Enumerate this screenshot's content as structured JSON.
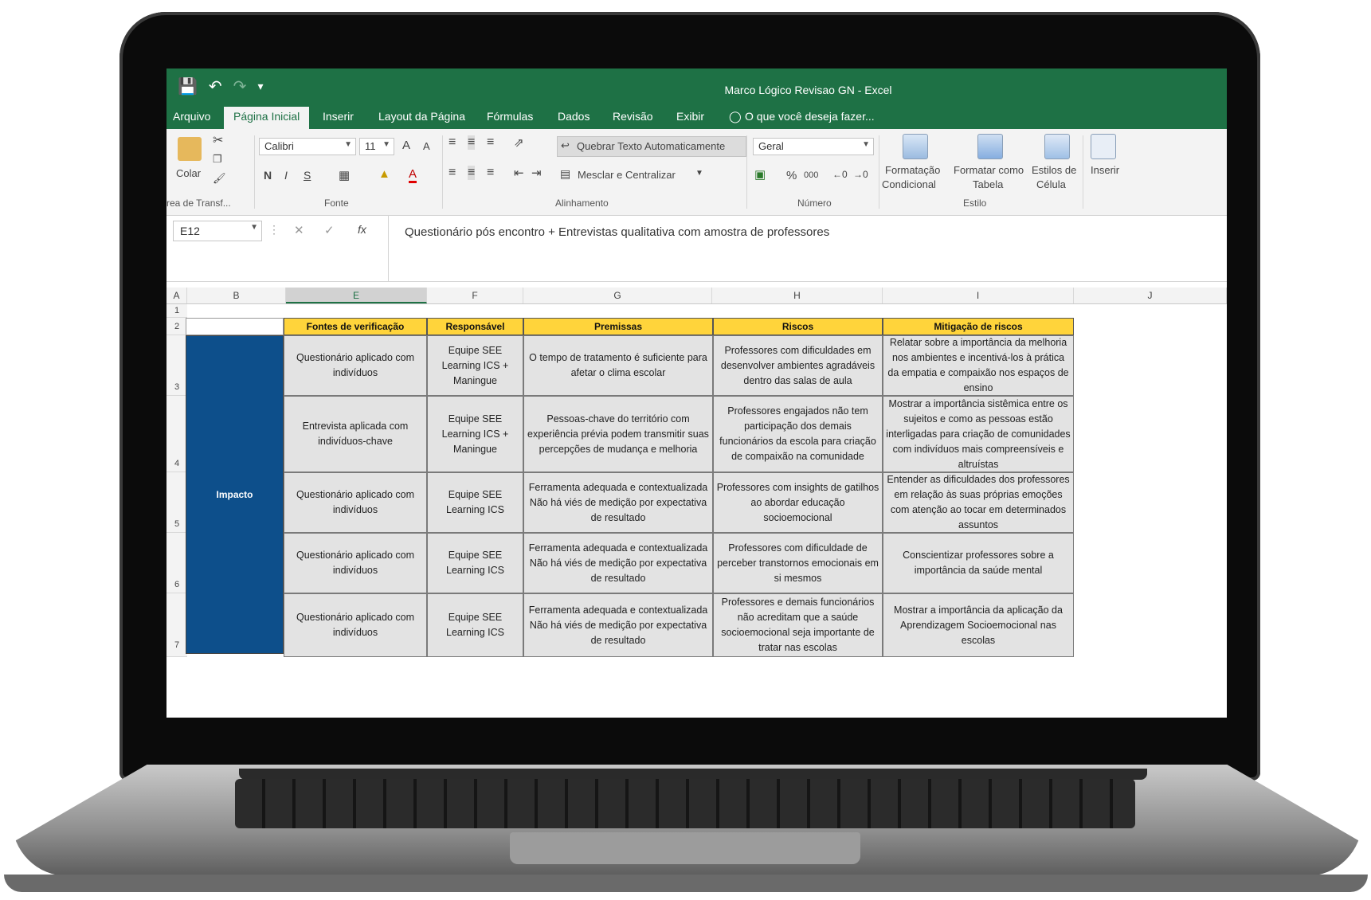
{
  "window": {
    "title": "Marco Lógico Revisao GN - Excel",
    "qat": {
      "save_icon": "save-icon",
      "undo_icon": "undo-icon",
      "redo_icon": "redo-icon"
    }
  },
  "tabs": [
    "Arquivo",
    "Página Inicial",
    "Inserir",
    "Layout da Página",
    "Fórmulas",
    "Dados",
    "Revisão",
    "Exibir"
  ],
  "tell_me": "O que você deseja fazer...",
  "ribbon": {
    "clipboard": {
      "paste_label": "Colar",
      "group": "Área de Transf..."
    },
    "font": {
      "name": "Calibri",
      "size": "11",
      "bold": "N",
      "italic": "I",
      "underline": "S",
      "grow": "A",
      "shrink": "A",
      "color_a": "A",
      "group": "Fonte"
    },
    "alignment": {
      "wrap": "Quebrar Texto Automaticamente",
      "merge": "Mesclar e Centralizar",
      "group": "Alinhamento"
    },
    "number": {
      "format": "Geral",
      "percent": "%",
      "thousands": "000",
      "group": "Número"
    },
    "styles": {
      "conditional": [
        "Formatação",
        "Condicional"
      ],
      "table": [
        "Formatar como",
        "Tabela"
      ],
      "cell": [
        "Estilos de",
        "Célula"
      ],
      "insert": "Inserir",
      "group": "Estilo"
    }
  },
  "formula_bar": {
    "name_box": "E12",
    "cancel": "✕",
    "confirm": "✓",
    "fx": "fx",
    "content": "Questionário pós encontro + Entrevistas qualitativa com amostra de professores"
  },
  "grid": {
    "col_headers": [
      "A",
      "B",
      "E",
      "F",
      "G",
      "H",
      "I",
      "J"
    ],
    "row_headers": [
      "1",
      "2",
      "3",
      "4",
      "5",
      "6",
      "7"
    ],
    "table_headers": [
      "Fontes de verificação",
      "Responsável",
      "Premissas",
      "Riscos",
      "Mitigação de riscos"
    ],
    "category": "Impacto",
    "rows": [
      {
        "fontes": "Questionário aplicado com indivíduos",
        "responsavel": "Equipe SEE Learning ICS + Maningue",
        "premissas": "O tempo de tratamento é suficiente para afetar o clima escolar",
        "riscos": "Professores com dificuldades em desenvolver ambientes agradáveis dentro das salas de aula",
        "mitigacao": "Relatar sobre a importância da melhoria nos ambientes e incentivá-los à prática da empatia e compaixão nos espaços de ensino"
      },
      {
        "fontes": "Entrevista aplicada com indivíduos-chave",
        "responsavel": "Equipe SEE Learning ICS + Maningue",
        "premissas": "Pessoas-chave do território com experiência prévia podem transmitir suas percepções de mudança e melhoria",
        "riscos": "Professores engajados não tem participação dos demais funcionários da escola para criação de compaixão na comunidade",
        "mitigacao": "Mostrar a importância sistêmica entre os sujeitos e como as pessoas estão interligadas para criação de comunidades com indivíduos mais compreensíveis e altruístas"
      },
      {
        "fontes": "Questionário aplicado com indivíduos",
        "responsavel": "Equipe SEE Learning ICS",
        "premissas": "Ferramenta adequada e contextualizada Não há viés de medição por expectativa de resultado",
        "riscos": "Professores com insights de gatilhos ao abordar educação socioemocional",
        "mitigacao": "Entender as dificuldades dos professores em relação às suas próprias emoções com atenção ao tocar em determinados assuntos"
      },
      {
        "fontes": "Questionário aplicado com indivíduos",
        "responsavel": "Equipe SEE Learning ICS",
        "premissas": "Ferramenta adequada e contextualizada Não há viés de medição por expectativa de resultado",
        "riscos": "Professores com dificuldade de perceber transtornos emocionais em si mesmos",
        "mitigacao": "Conscientizar professores sobre a importância da saúde mental"
      },
      {
        "fontes": "Questionário aplicado com indivíduos",
        "responsavel": "Equipe SEE Learning ICS",
        "premissas": "Ferramenta adequada e contextualizada Não há viés de medição por expectativa de resultado",
        "riscos": "Professores e demais funcionários não acreditam que a saúde socioemocional seja importante de tratar nas escolas",
        "mitigacao": "Mostrar a importância da aplicação da Aprendizagem Socioemocional nas escolas"
      }
    ]
  },
  "colors": {
    "excel_green": "#1e7145",
    "header_yellow": "#ffd43b",
    "impact_blue": "#0d4f8b",
    "cell_gray": "#e3e3e3"
  }
}
